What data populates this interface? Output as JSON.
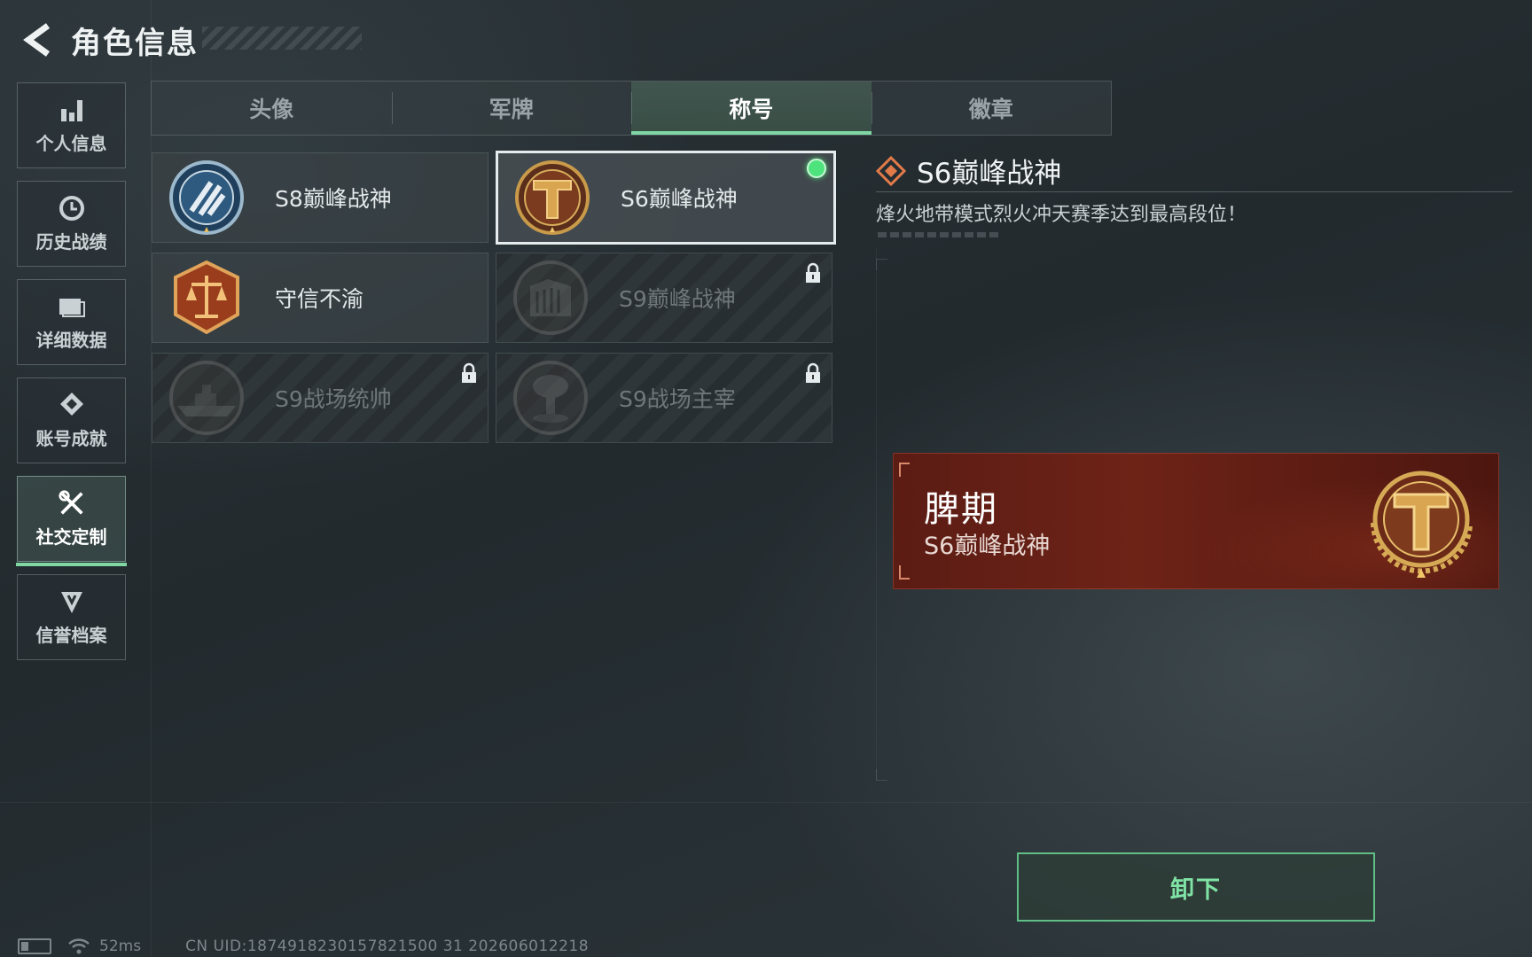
{
  "header": {
    "title": "角色信息"
  },
  "sidebar": {
    "items": [
      {
        "label": "个人信息",
        "icon": "bar-chart-icon",
        "active": false
      },
      {
        "label": "历史战绩",
        "icon": "history-clock-icon",
        "active": false
      },
      {
        "label": "详细数据",
        "icon": "folder-icon",
        "active": false
      },
      {
        "label": "账号成就",
        "icon": "achievement-icon",
        "active": false
      },
      {
        "label": "社交定制",
        "icon": "tools-icon",
        "active": true
      },
      {
        "label": "信誉档案",
        "icon": "honor-icon",
        "active": false
      }
    ]
  },
  "tabs": [
    {
      "label": "头像",
      "active": false
    },
    {
      "label": "军牌",
      "active": false
    },
    {
      "label": "称号",
      "active": true
    },
    {
      "label": "徽章",
      "active": false
    }
  ],
  "titles": [
    {
      "name": "S8巅峰战神",
      "emblem": "blue-slash-emblem",
      "locked": false,
      "selected": false
    },
    {
      "name": "S6巅峰战神",
      "emblem": "gold-t-emblem",
      "locked": false,
      "selected": true,
      "equipped": true
    },
    {
      "name": "守信不渝",
      "emblem": "scales-emblem",
      "locked": false,
      "selected": false
    },
    {
      "name": "S9巅峰战神",
      "emblem": "fortress-emblem",
      "locked": true,
      "selected": false
    },
    {
      "name": "S9战场统帅",
      "emblem": "warship-emblem",
      "locked": true,
      "selected": false
    },
    {
      "name": "S9战场主宰",
      "emblem": "mushroom-cloud-emblem",
      "locked": true,
      "selected": false
    }
  ],
  "detail": {
    "title": "S6巅峰战神",
    "description": "烽火地带模式烈火冲天赛季达到最高段位！"
  },
  "preview": {
    "player_name": "脾期",
    "title": "S6巅峰战神"
  },
  "actions": {
    "unequip_label": "卸下"
  },
  "status": {
    "ping": "52ms",
    "uid": "CN UID:1874918230157821500 31 202606012218"
  },
  "colors": {
    "accent": "#7fd7a3",
    "banner": "#6e2317",
    "equipped_dot": "#4fe37e"
  }
}
